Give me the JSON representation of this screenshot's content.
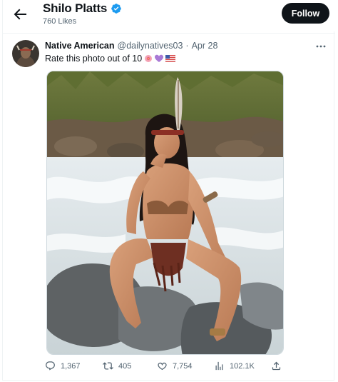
{
  "header": {
    "title": "Shilo Platts",
    "subtitle": "760 Likes",
    "follow_label": "Follow"
  },
  "tweet": {
    "author_name": "Native American",
    "handle": "@dailynatives03",
    "separator": "·",
    "date": "Apr 28",
    "text": "Rate this photo out of 10",
    "emojis": [
      "rosette-icon",
      "purple-heart-icon",
      "us-flag-icon"
    ]
  },
  "actions": {
    "replies": "1,367",
    "reposts": "405",
    "likes": "7,754",
    "views": "102.1K"
  },
  "colors": {
    "accent": "#1d9bf0",
    "text": "#0f1419",
    "muted": "#536471",
    "follow_bg": "#0f1419"
  }
}
